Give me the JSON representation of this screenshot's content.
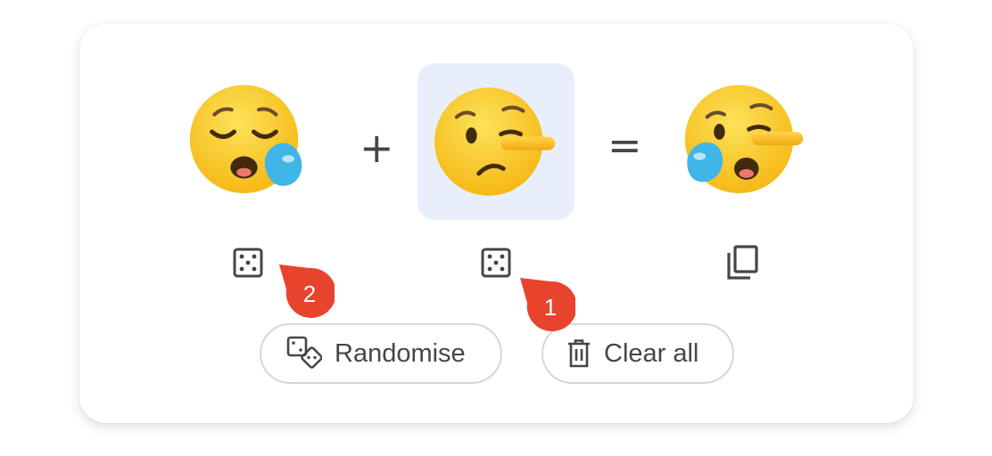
{
  "mixer": {
    "left_emoji": {
      "name": "sleepy-face-icon"
    },
    "right_emoji": {
      "name": "lying-face-icon",
      "selected": true
    },
    "result_emoji": {
      "name": "sleepy-lying-face-icon"
    },
    "plus": "+",
    "equals": "="
  },
  "actions": {
    "randomise_label": "Randomise",
    "clear_label": "Clear all"
  },
  "markers": [
    {
      "number": "2"
    },
    {
      "number": "1"
    }
  ],
  "colors": {
    "selected_bg": "#e8effa",
    "marker": "#e8432d",
    "emoji_yellow": "#fcc21b",
    "tear_blue": "#40c0e7",
    "text": "#444746"
  }
}
